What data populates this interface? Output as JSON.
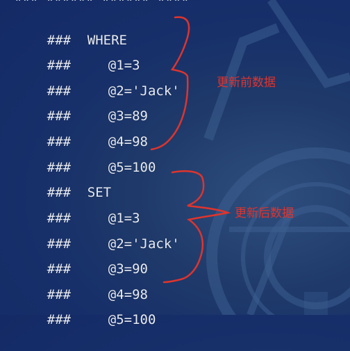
{
  "terminal": {
    "prefix": "###",
    "where_keyword": "WHERE",
    "set_keyword": "SET",
    "before_values": [
      "@1=3",
      "@2='Jack'",
      "@3=89",
      "@4=98",
      "@5=100"
    ],
    "after_values": [
      "@1=3",
      "@2='Jack'",
      "@3=90",
      "@4=98",
      "@5=100"
    ]
  },
  "annotations": {
    "before_label": "更新前数据",
    "after_label": "更新后数据"
  },
  "colors": {
    "background": "#17306a",
    "text": "#e8ecf4",
    "annotation": "#e0342c"
  }
}
